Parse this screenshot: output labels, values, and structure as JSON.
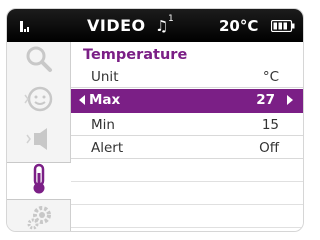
{
  "status_bar": {
    "source": "VIDEO",
    "music_badge": "1",
    "temperature": "20°C",
    "icons": [
      "signal-icon",
      "music-note-icon",
      "battery-icon"
    ]
  },
  "sidebar": {
    "items": [
      {
        "name": "search",
        "icon": "search-icon",
        "active": false
      },
      {
        "name": "lullaby",
        "icon": "smiley-icon",
        "active": false
      },
      {
        "name": "volume",
        "icon": "speaker-icon",
        "active": false
      },
      {
        "name": "temperature",
        "icon": "thermometer-icon",
        "active": true
      },
      {
        "name": "settings",
        "icon": "gear-icon",
        "active": false
      }
    ]
  },
  "panel": {
    "title": "Temperature",
    "rows": [
      {
        "label": "Unit",
        "value": "°C",
        "selected": false
      },
      {
        "label": "Max",
        "value": "27",
        "selected": true
      },
      {
        "label": "Min",
        "value": "15",
        "selected": false
      },
      {
        "label": "Alert",
        "value": "Off",
        "selected": false
      }
    ]
  },
  "colors": {
    "accent": "#7b1f86",
    "status_bar": "#000000",
    "text": "#333333"
  }
}
